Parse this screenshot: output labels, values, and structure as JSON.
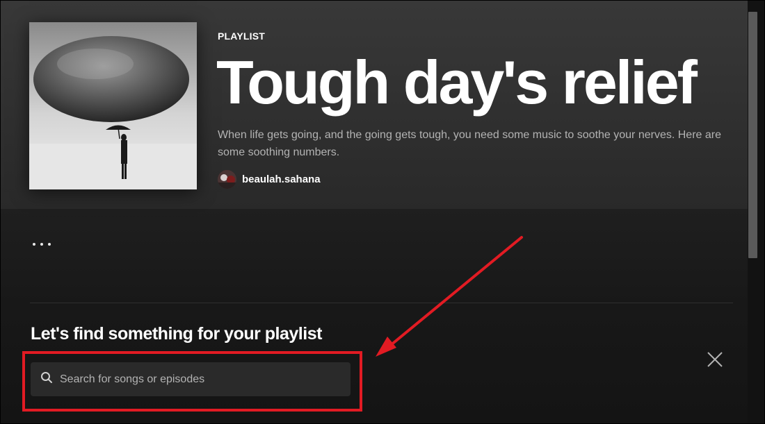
{
  "playlist": {
    "eyebrow": "PLAYLIST",
    "title": "Tough day's relief",
    "description": "When life gets going, and the going gets tough, you need some music to soothe your nerves. Here are some soothing numbers.",
    "owner": "beaulah.sahana"
  },
  "find_section": {
    "heading": "Let's find something for your playlist",
    "search_placeholder": "Search for songs or episodes"
  },
  "icons": {
    "search": "search-icon",
    "close": "close-icon",
    "more": "more-options-icon"
  },
  "colors": {
    "annotation": "#e21b23",
    "text_primary": "#ffffff",
    "text_secondary": "#b3b3b3"
  }
}
